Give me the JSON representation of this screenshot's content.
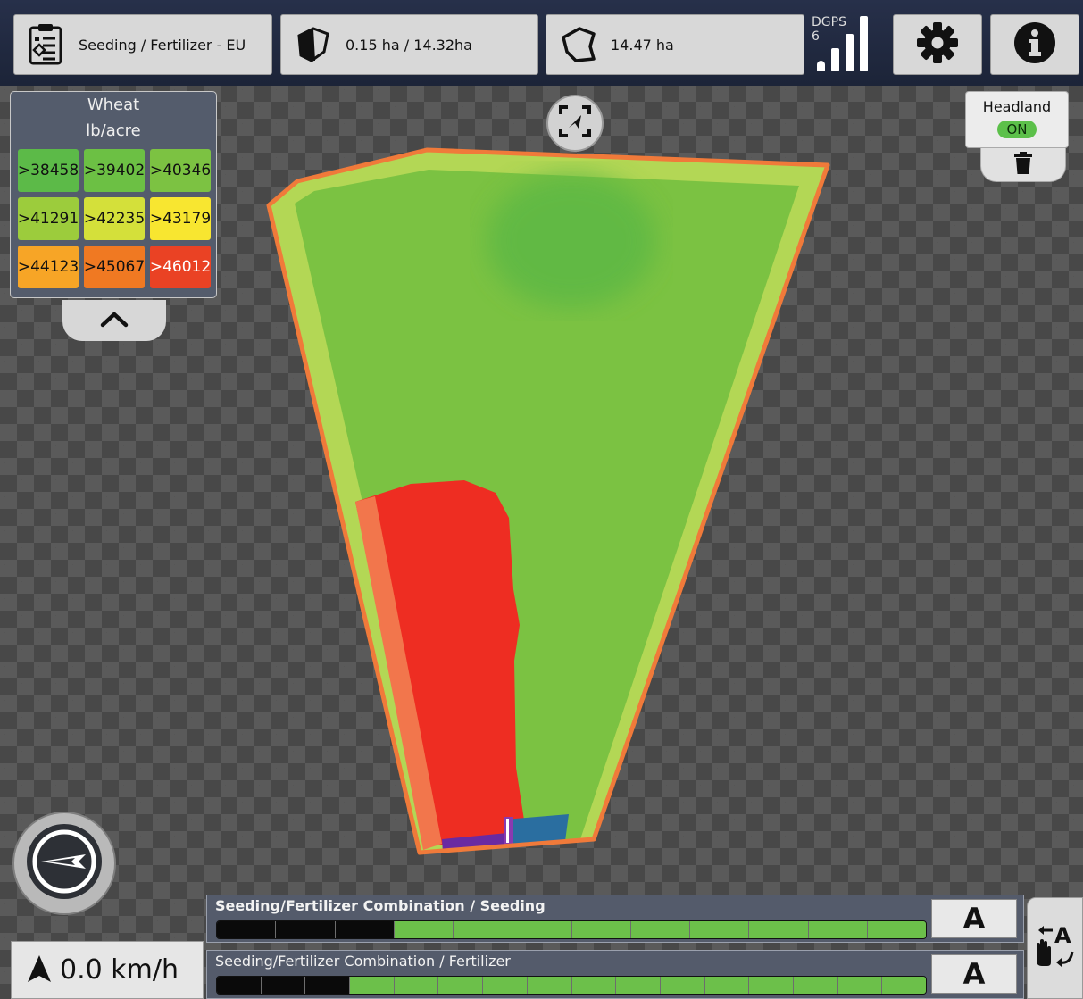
{
  "top_bar": {
    "job_label": "Seeding / Fertilizer - EU",
    "job_icon": "clipboard-task-icon",
    "worked_area_label": "0.15 ha / 14.32ha",
    "worked_area_icon": "field-partial-icon",
    "field_area_label": "14.47 ha",
    "field_area_icon": "field-boundary-icon",
    "gps": {
      "mode": "DGPS",
      "satellites": "6",
      "signal_bars": 4,
      "icon": "signal-bars-icon"
    },
    "settings_icon": "gear-icon",
    "info_icon": "info-icon"
  },
  "legend": {
    "crop": "Wheat",
    "unit": "lb/acre",
    "toggle_icon": "chevron-up-icon",
    "classes": [
      {
        "label": ">38458",
        "color": "#5cba48"
      },
      {
        "label": ">39402",
        "color": "#6cc044"
      },
      {
        "label": ">40346",
        "color": "#7cc242"
      },
      {
        "label": ">41291",
        "color": "#9ccc3c"
      },
      {
        "label": ">42235",
        "color": "#d4e03a"
      },
      {
        "label": ">43179",
        "color": "#f8e630"
      },
      {
        "label": ">44123",
        "color": "#f7a526"
      },
      {
        "label": ">45067",
        "color": "#f07922"
      },
      {
        "label": ">46012",
        "color": "#ea4224"
      }
    ]
  },
  "map": {
    "recenter_icon": "recenter-map-icon",
    "boundary_color": "#f07a3a",
    "headland_color": "#b3d755",
    "field_color": "#7bc242",
    "applied_color": "#ee2d22"
  },
  "headland": {
    "label": "Headland",
    "state": "ON",
    "delete_icon": "trash-icon"
  },
  "compass": {
    "icon": "compass-icon"
  },
  "speed": {
    "value": "0.0 km/h",
    "icon": "heading-arrow-icon"
  },
  "sections": [
    {
      "label": "Seeding/Fertilizer Combination / Seeding",
      "active": true,
      "off_segments": 3,
      "total_segments": 12,
      "mode": "A"
    },
    {
      "label": "Seeding/Fertilizer Combination / Fertilizer",
      "active": false,
      "off_segments": 3,
      "total_segments": 16,
      "mode": "A"
    }
  ],
  "mode_switch_icon": "auto-manual-switch-icon",
  "colors": {
    "section_on": "#6cc04a",
    "section_off": "#0a0a0a",
    "top_bar": "#1f2740",
    "panel": "#545b6b"
  }
}
